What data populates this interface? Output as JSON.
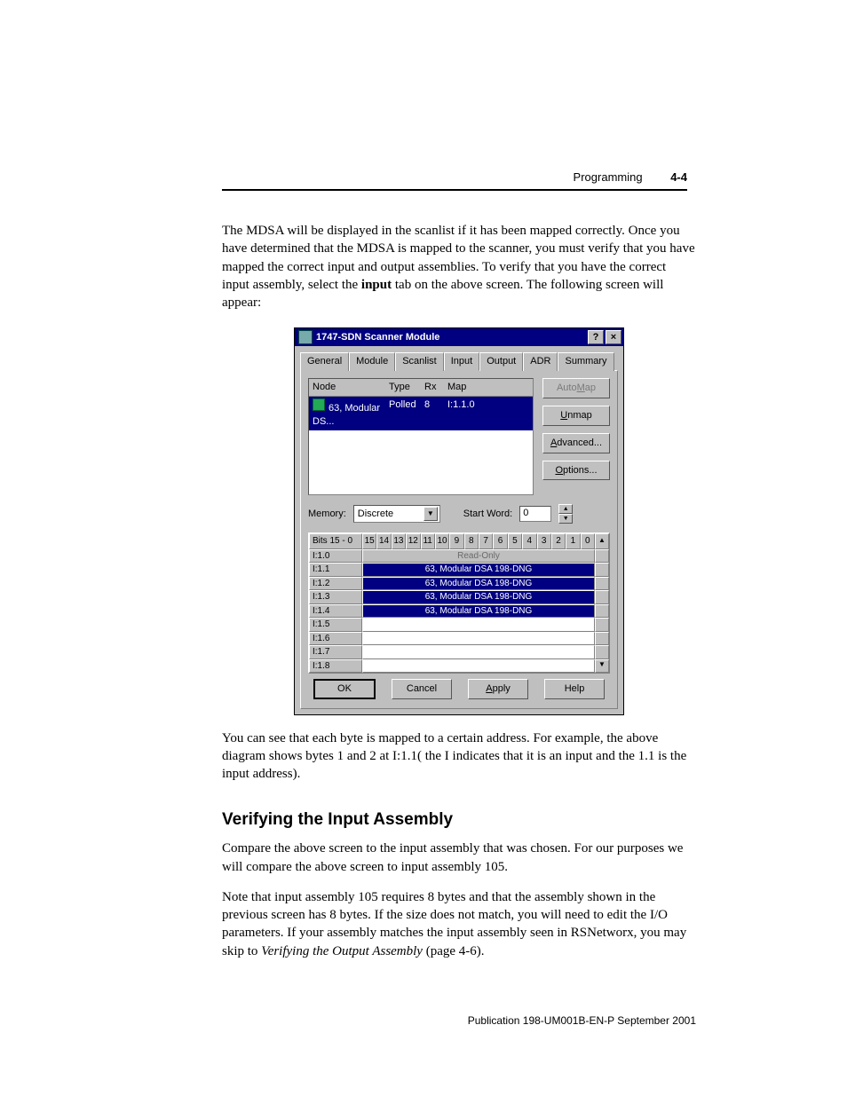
{
  "header": {
    "section": "Programming",
    "page_num": "4-4"
  },
  "para1_a": "The MDSA will be displayed in the scanlist if it has been mapped correctly. Once you have determined that the MDSA is mapped to the scanner, you must verify that you have mapped the correct input and output assemblies. To verify that you have the correct input assembly, select the ",
  "para1_bold": "input",
  "para1_b": " tab on the above screen. The following screen will appear:",
  "dialog": {
    "title": "1747-SDN Scanner Module",
    "help_btn": "?",
    "close_btn": "×",
    "tabs": [
      "General",
      "Module",
      "Scanlist",
      "Input",
      "Output",
      "ADR",
      "Summary"
    ],
    "active_tab_index": 3,
    "scanlist": {
      "headers": {
        "node": "Node",
        "type": "Type",
        "rx": "Rx",
        "map": "Map"
      },
      "row": {
        "node": "63, Modular DS...",
        "type": "Polled",
        "rx": "8",
        "map": "I:1.1.0"
      }
    },
    "side_buttons": {
      "automap": {
        "pre": "Auto",
        "u": "M",
        "post": "ap"
      },
      "unmap": {
        "u": "U",
        "post": "nmap"
      },
      "advanced": {
        "u": "A",
        "post": "dvanced..."
      },
      "options": {
        "u": "O",
        "post": "ptions..."
      }
    },
    "memory_label": "Memory:",
    "memory_value": "Discrete",
    "start_word_label": "Start Word:",
    "start_word_value": "0",
    "bits_label": "Bits 15 - 0",
    "bit_headers": [
      "15",
      "14",
      "13",
      "12",
      "11",
      "10",
      "9",
      "8",
      "7",
      "6",
      "5",
      "4",
      "3",
      "2",
      "1",
      "0"
    ],
    "rows": [
      {
        "addr": "I:1.0",
        "type": "readonly",
        "text": "Read-Only"
      },
      {
        "addr": "I:1.1",
        "type": "mapped",
        "text": "63, Modular DSA 198-DNG"
      },
      {
        "addr": "I:1.2",
        "type": "mapped",
        "text": "63, Modular DSA 198-DNG"
      },
      {
        "addr": "I:1.3",
        "type": "mapped",
        "text": "63, Modular DSA 198-DNG"
      },
      {
        "addr": "I:1.4",
        "type": "mapped",
        "text": "63, Modular DSA 198-DNG"
      },
      {
        "addr": "I:1.5",
        "type": "empty",
        "text": ""
      },
      {
        "addr": "I:1.6",
        "type": "empty",
        "text": ""
      },
      {
        "addr": "I:1.7",
        "type": "empty",
        "text": ""
      },
      {
        "addr": "I:1.8",
        "type": "empty",
        "text": ""
      }
    ],
    "buttons": {
      "ok": "OK",
      "cancel": "Cancel",
      "apply": {
        "u": "A",
        "post": "pply"
      },
      "help": "Help"
    }
  },
  "para2": "You can see that each byte is mapped to a certain address. For example, the above diagram shows bytes 1 and 2 at I:1.1( the I indicates that it is an input and the 1.1 is the input address).",
  "section_heading": "Verifying the Input Assembly",
  "para3": "Compare the above screen to the input assembly that was chosen. For our purposes we will compare the above screen to input assembly 105.",
  "para4_a": "Note that input assembly 105 requires 8 bytes and that the assembly shown in the previous screen has 8 bytes. If the size does not match, you will need to edit the I/O parameters. If your assembly matches the input assembly seen in RSNetworx, you may skip to ",
  "para4_italic": "Verifying the Output Assembly",
  "para4_b": " (page 4-6).",
  "footer": "Publication 198-UM001B-EN-P  September 2001"
}
